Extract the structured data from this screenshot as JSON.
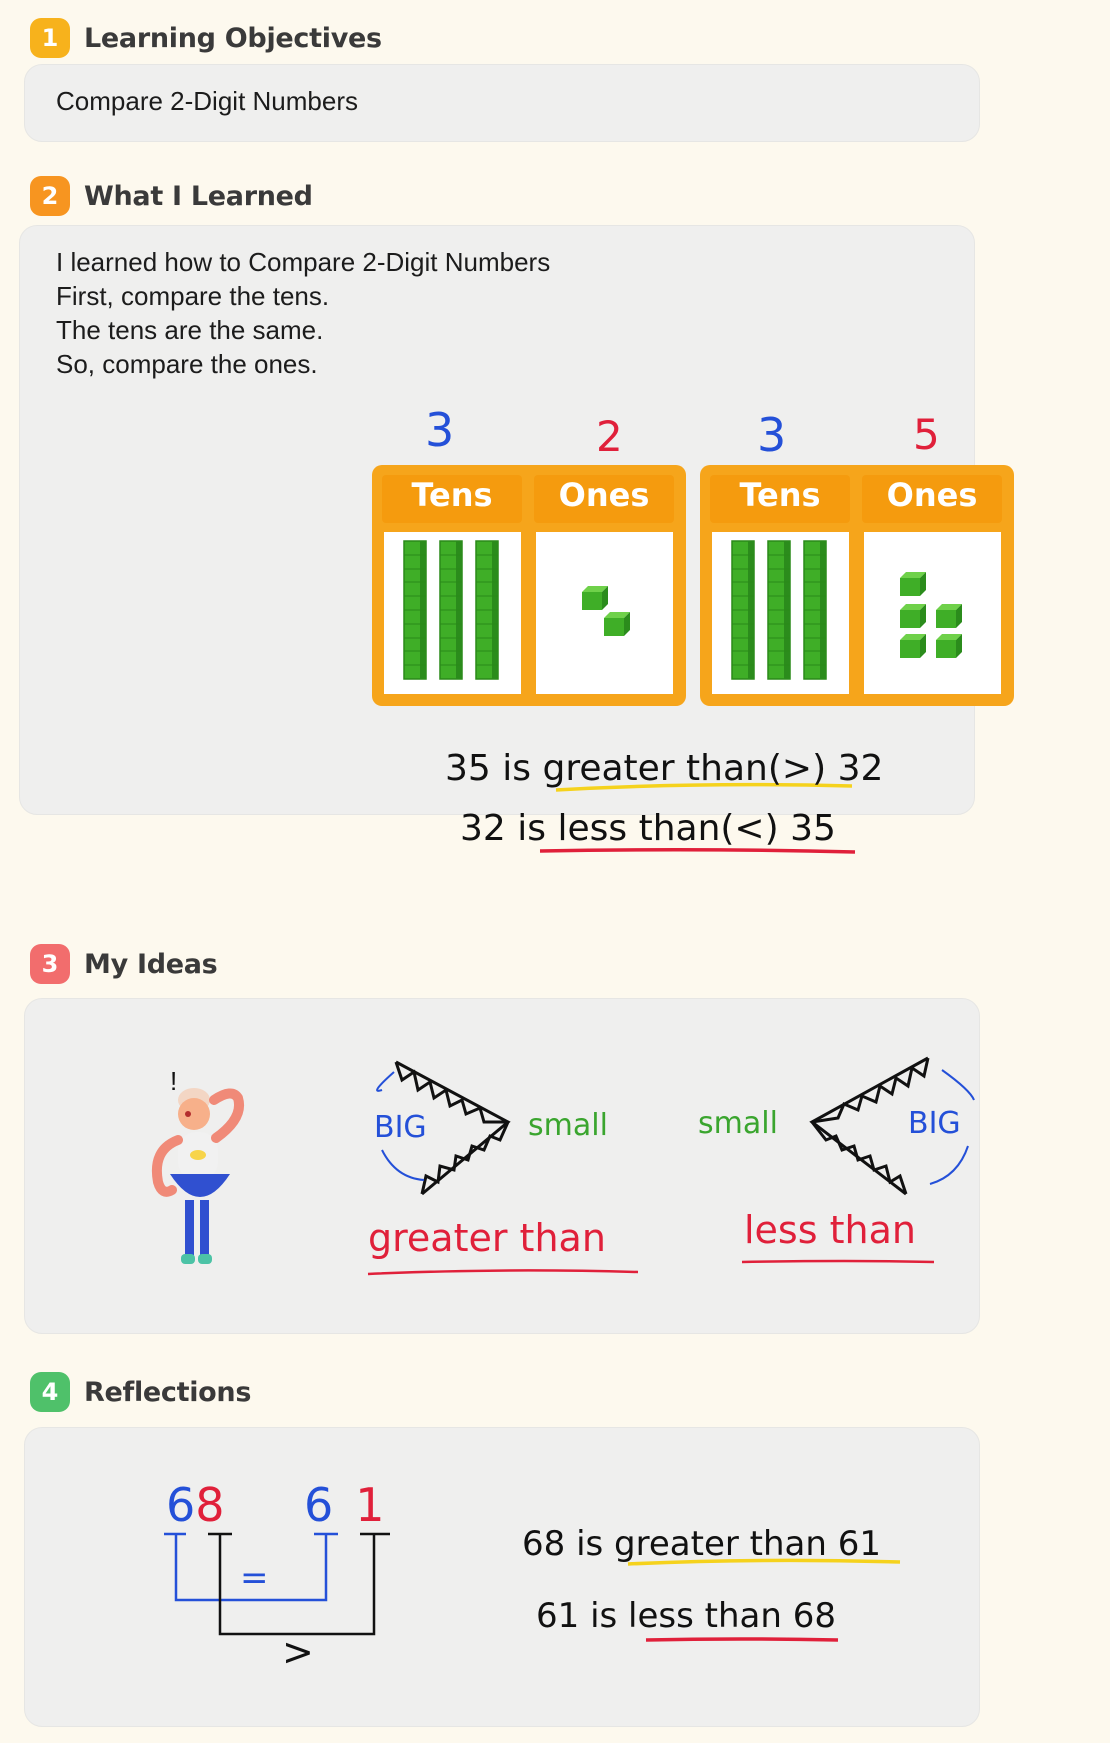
{
  "sections": [
    {
      "number": "1",
      "title": "Learning Objectives",
      "color": "#f7b21c"
    },
    {
      "number": "2",
      "title": "What I Learned",
      "color": "#f79520"
    },
    {
      "number": "3",
      "title": "My Ideas",
      "color": "#f26d6d"
    },
    {
      "number": "4",
      "title": "Reflections",
      "color": "#4fc16a"
    }
  ],
  "objectives": {
    "text": "Compare 2-Digit Numbers"
  },
  "learned": {
    "lines": [
      "I learned how to Compare 2-Digit Numbers",
      "First, compare the tens.",
      "The tens are the same.",
      "So, compare the ones."
    ],
    "chart_left": {
      "tens_digit": "3",
      "ones_digit": "2",
      "tens_label": "Tens",
      "ones_label": "Ones"
    },
    "chart_right": {
      "tens_digit": "3",
      "ones_digit": "5",
      "tens_label": "Tens",
      "ones_label": "Ones"
    },
    "statement_1": {
      "a": "35 is",
      "rel": "greater than",
      "sym": "(>)",
      "b": "32"
    },
    "statement_2": {
      "a": "32",
      "rel": "is less than",
      "sym": "(<)",
      "b": "35"
    }
  },
  "ideas": {
    "left": {
      "big": "BIG",
      "small": "small",
      "caption": "greater than"
    },
    "right": {
      "big": "BIG",
      "small": "small",
      "caption": "less than"
    },
    "character_mark": "!"
  },
  "reflections": {
    "num_a_tens": "6",
    "num_a_ones": "8",
    "num_b_tens": "6",
    "num_b_ones": "1",
    "equal_sign": "=",
    "greater_sign": ">",
    "line_1": {
      "a": "68 is",
      "rel": "greater than",
      "b": "61"
    },
    "line_2": {
      "a": "61 is",
      "rel": "less than",
      "b": "68"
    }
  },
  "colors": {
    "blue": "#2450d8",
    "red": "#e0203a",
    "green": "#3aa52e",
    "yellow_underline": "#f5d21c",
    "red_underline": "#e0203a",
    "orange": "#f6a51b"
  }
}
